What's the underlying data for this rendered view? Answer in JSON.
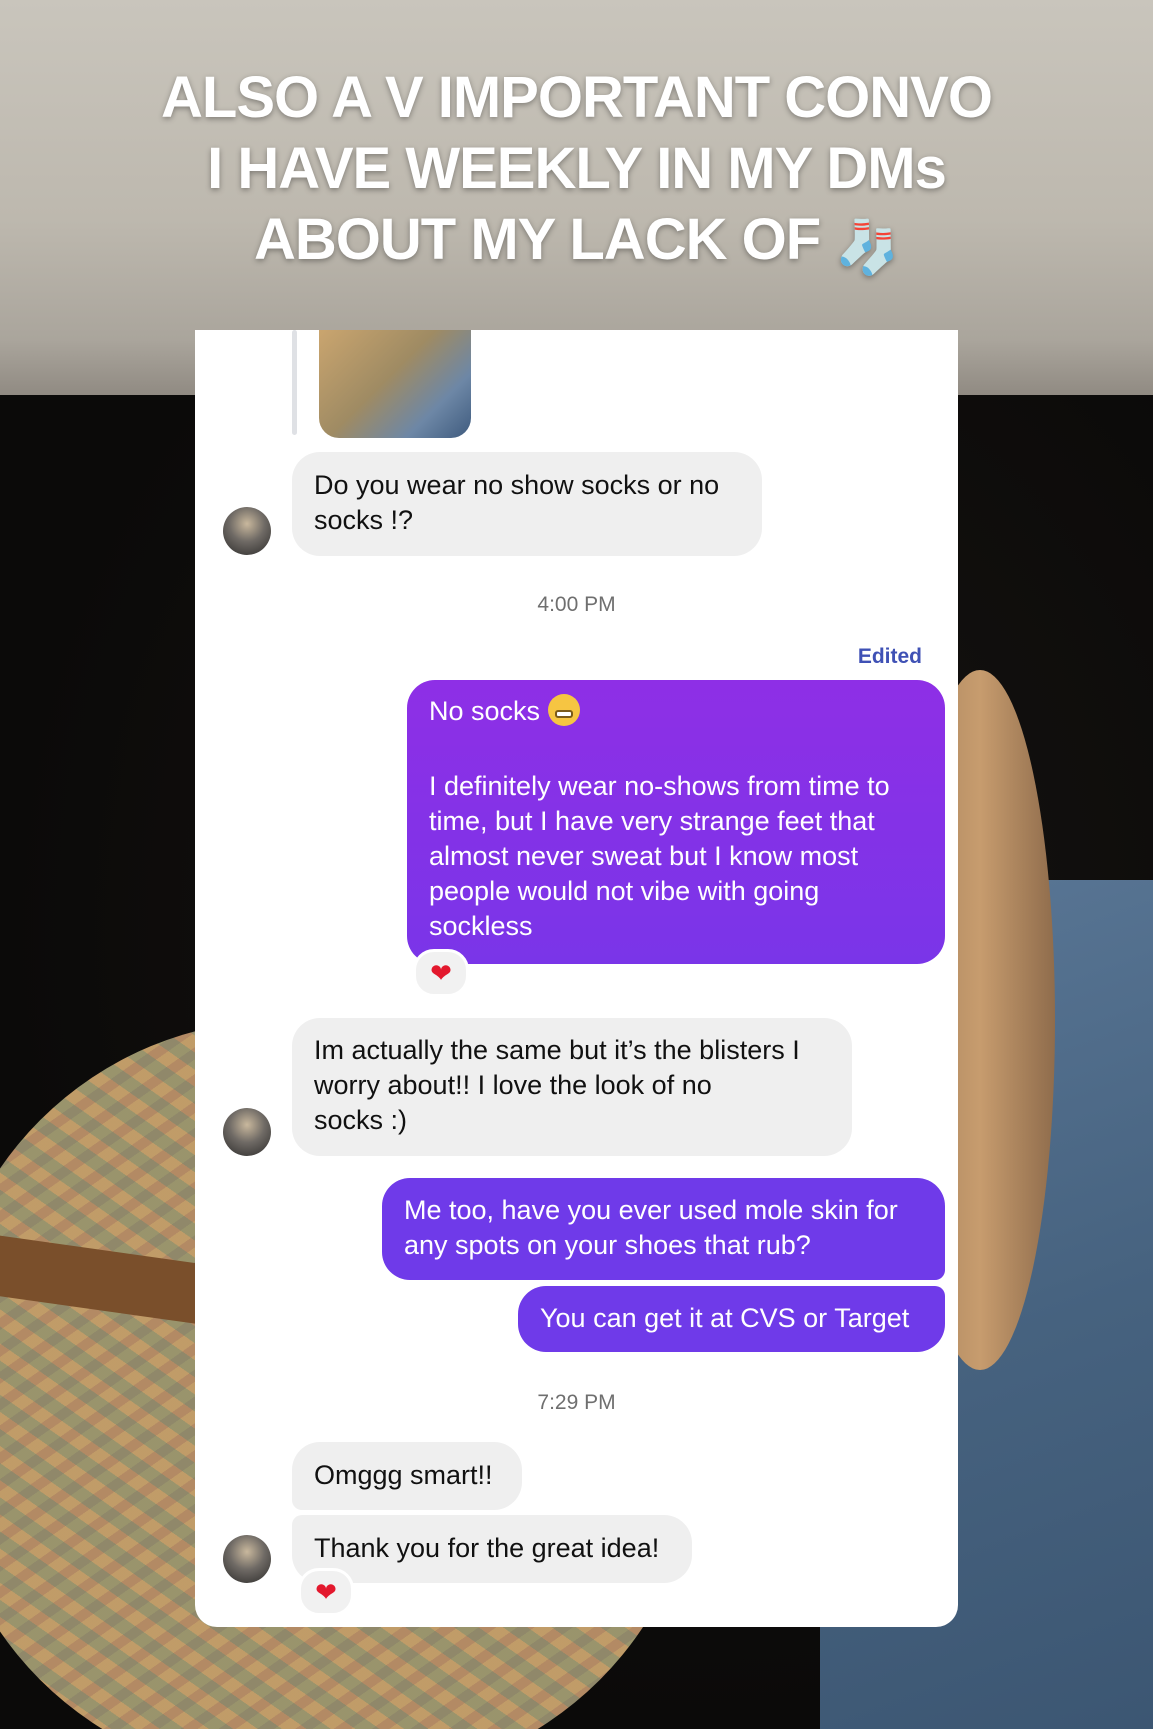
{
  "story": {
    "headline": [
      "ALSO A V IMPORTANT CONVO",
      "I HAVE WEEKLY IN MY DMs",
      "ABOUT MY LACK OF"
    ],
    "headline_emoji": "sock-emoji"
  },
  "thread": {
    "edited_label": "Edited",
    "timestamps": [
      "4:00 PM",
      "7:29 PM"
    ],
    "messages": [
      {
        "side": "in",
        "text": "Do you wear no show socks or no\nsocks !?"
      },
      {
        "side": "out",
        "text": "No socks",
        "emoji": "grimacing-face"
      },
      {
        "side": "out",
        "text": "I definitely wear no-shows from time to\ntime, but I have very strange feet that\nalmost never sweat but I know most\npeople would not vibe with going\nsockless"
      },
      {
        "side": "in",
        "text": "Im actually the same but it’s the blisters I\nworry about!! I love the look of no\nsocks :)"
      },
      {
        "side": "out",
        "text": "Me too, have you ever used mole skin for\nany spots on your shoes that rub?"
      },
      {
        "side": "out",
        "text": "You can get it at CVS or Target"
      },
      {
        "side": "in",
        "text": "Omggg smart!!"
      },
      {
        "side": "in",
        "text": "Thank you for the great idea!"
      }
    ],
    "reaction": "❤"
  },
  "colors": {
    "incoming_bubble": "#efefef",
    "outgoing_bubble_start": "#8e2fe6",
    "outgoing_bubble_end": "#6f3ae9",
    "edited_label": "#3f51b5"
  }
}
